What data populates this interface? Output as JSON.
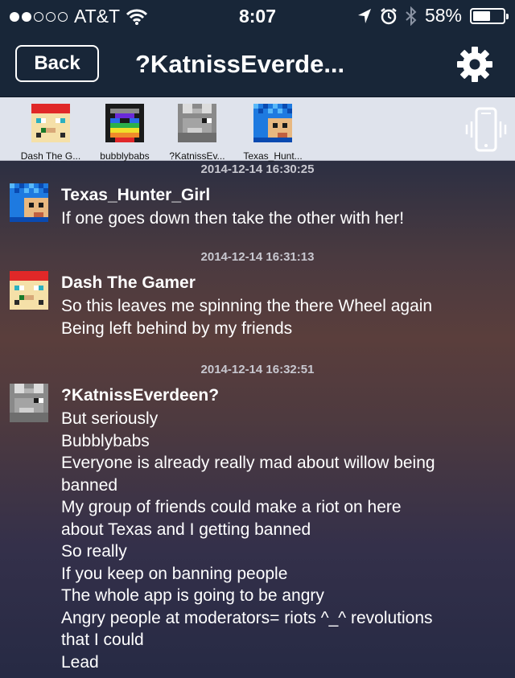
{
  "status_bar": {
    "carrier": "AT&T",
    "time": "8:07",
    "battery": "58%",
    "battery_level": 0.58
  },
  "nav": {
    "back_label": "Back",
    "title": "?KatnissEverde...",
    "settings_icon": "gear-icon"
  },
  "members": [
    {
      "label": "Dash The G...",
      "avatar": "santa-pixel-avatar"
    },
    {
      "label": "bubblybabs",
      "avatar": "rainbow-pixel-avatar"
    },
    {
      "label": "?KatnissEv...",
      "avatar": "gray-pixel-avatar"
    },
    {
      "label": "Texas_Hunt...",
      "avatar": "blue-pixel-avatar"
    }
  ],
  "messages": [
    {
      "timestamp": "2014-12-14 16:30:25",
      "author": "Texas_Hunter_Girl",
      "avatar": "blue-pixel-avatar",
      "lines": [
        "If one goes down then take the other with her!"
      ]
    },
    {
      "timestamp": "2014-12-14 16:31:13",
      "author": "Dash The Gamer",
      "avatar": "santa-pixel-avatar",
      "lines": [
        "So this leaves me spinning the there Wheel again",
        "Being left behind by my friends"
      ]
    },
    {
      "timestamp": "2014-12-14 16:32:51",
      "author": "?KatnissEverdeen?",
      "avatar": "gray-pixel-avatar",
      "lines": [
        "But seriously",
        "Bubblybabs",
        "Everyone is already really mad about willow being",
        "banned",
        "My group of friends could make a riot on here",
        "about Texas and I getting banned",
        "So really",
        "If you keep on banning people",
        "The whole app is going to be angry",
        "Angry people at moderators= riots ^_^ revolutions",
        "that I could",
        "Lead"
      ]
    }
  ],
  "colors": {
    "nav_bg": "#182638",
    "member_strip_bg": "#dfe3ec",
    "timestamp": "#c8c8d0"
  }
}
